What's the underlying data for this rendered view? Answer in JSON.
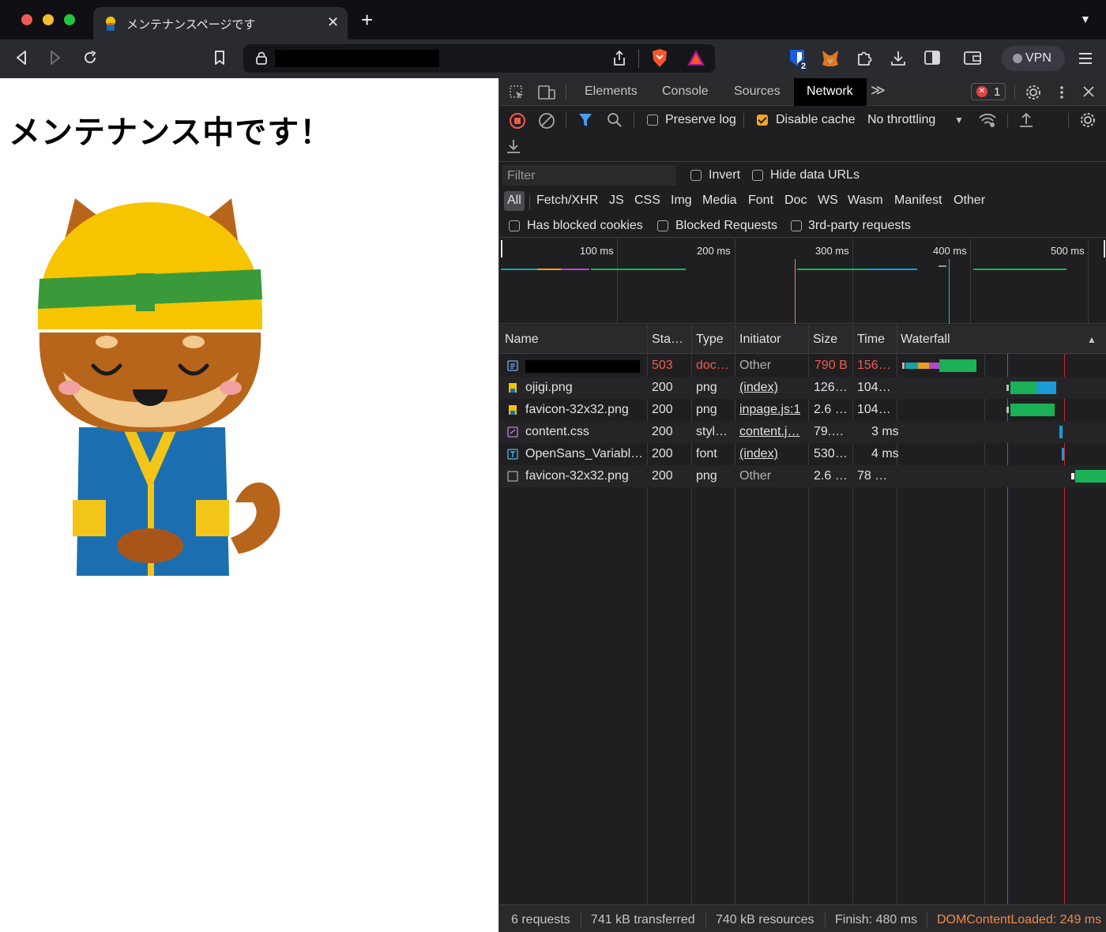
{
  "browser": {
    "tab_title": "メンテナンスページです",
    "new_tab_symbol": "+",
    "vpn_label": "VPN",
    "extension_badge": "2"
  },
  "page": {
    "heading": "メンテナンス中です！",
    "illustration": "ojigi-dog-construction-worker"
  },
  "devtools": {
    "tabs": [
      "Elements",
      "Console",
      "Sources",
      "Network"
    ],
    "more_tabs": "≫",
    "error_count": "1",
    "controls": {
      "preserve_log": "Preserve log",
      "preserve_log_checked": false,
      "disable_cache": "Disable cache",
      "disable_cache_checked": true,
      "throttling": "No throttling"
    },
    "filter": {
      "placeholder": "Filter",
      "invert": "Invert",
      "hide_data_urls": "Hide data URLs",
      "types": [
        "All",
        "Fetch/XHR",
        "JS",
        "CSS",
        "Img",
        "Media",
        "Font",
        "Doc",
        "WS",
        "Wasm",
        "Manifest",
        "Other"
      ],
      "active_type": "All",
      "has_blocked_cookies": "Has blocked cookies",
      "blocked_requests": "Blocked Requests",
      "third_party": "3rd-party requests"
    },
    "overview_ticks": [
      "100 ms",
      "200 ms",
      "300 ms",
      "400 ms",
      "500 ms"
    ],
    "columns": [
      "Name",
      "Sta…",
      "Type",
      "Initiator",
      "Size",
      "Time",
      "Waterfall"
    ],
    "rows": [
      {
        "name": "",
        "status": "503",
        "type": "doc…",
        "initiator": "Other",
        "size": "790 B",
        "time": "156…",
        "icon": "document-icon"
      },
      {
        "name": "ojigi.png",
        "status": "200",
        "type": "png",
        "initiator": "(index)",
        "size": "126…",
        "time": "104…",
        "icon": "image-icon"
      },
      {
        "name": "favicon-32x32.png",
        "status": "200",
        "type": "png",
        "initiator": "inpage.js:1",
        "size": "2.6 …",
        "time": "104…",
        "icon": "image-icon"
      },
      {
        "name": "content.css",
        "status": "200",
        "type": "styl…",
        "initiator": "content.j…",
        "size": "79.…",
        "time": "3 ms",
        "icon": "stylesheet-icon"
      },
      {
        "name": "OpenSans_Variabl…",
        "status": "200",
        "type": "font",
        "initiator": "(index)",
        "size": "530…",
        "time": "4 ms",
        "icon": "font-icon"
      },
      {
        "name": "favicon-32x32.png",
        "status": "200",
        "type": "png",
        "initiator": "Other",
        "size": "2.6 …",
        "time": "78 …",
        "icon": "other-icon"
      }
    ],
    "status_bar": {
      "requests": "6 requests",
      "transferred": "741 kB transferred",
      "resources": "740 kB resources",
      "finish": "Finish: 480 ms",
      "dom_content_loaded": "DOMContentLoaded: 249 ms"
    },
    "colors": {
      "dom_content_loaded": "#f0884a",
      "error": "#f05a4f",
      "accent_checkbox": "#f5a623",
      "waterfall_green": "#1ab157",
      "waterfall_blue": "#1a9bd8"
    }
  }
}
